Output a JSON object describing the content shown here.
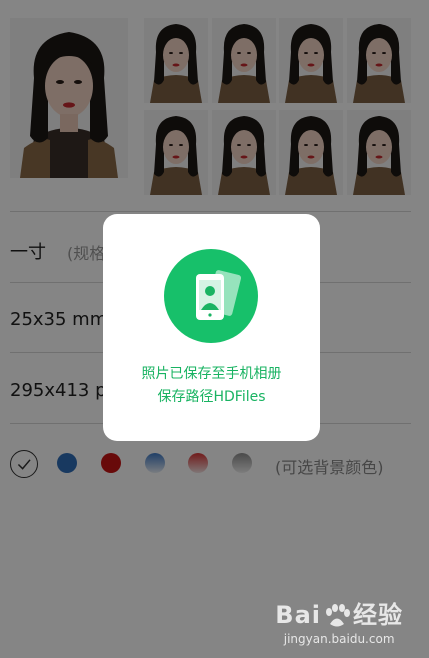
{
  "photos": {
    "large_alt": "portrait-large",
    "grid_count": 8
  },
  "spec": {
    "name": "一寸",
    "name_note": "(规格"
  },
  "size_mm": "25x35 mm",
  "size_px": "295x413 px",
  "background": {
    "colors": [
      "#ffffff",
      "#2f6db8",
      "#c81414",
      "#3e7ac6",
      "#d93434",
      "#8e8e8e"
    ],
    "note": "(可选背景颜色)"
  },
  "dialog": {
    "line1": "照片已保存至手机相册",
    "line2": "保存路径HDFiles",
    "icon": "saved-photo-icon",
    "accent": "#17c06a"
  },
  "watermark": {
    "brand": "Bai 经验",
    "brand_left": "Bai",
    "brand_right": "经验",
    "site": "jingyan.baidu.com"
  }
}
